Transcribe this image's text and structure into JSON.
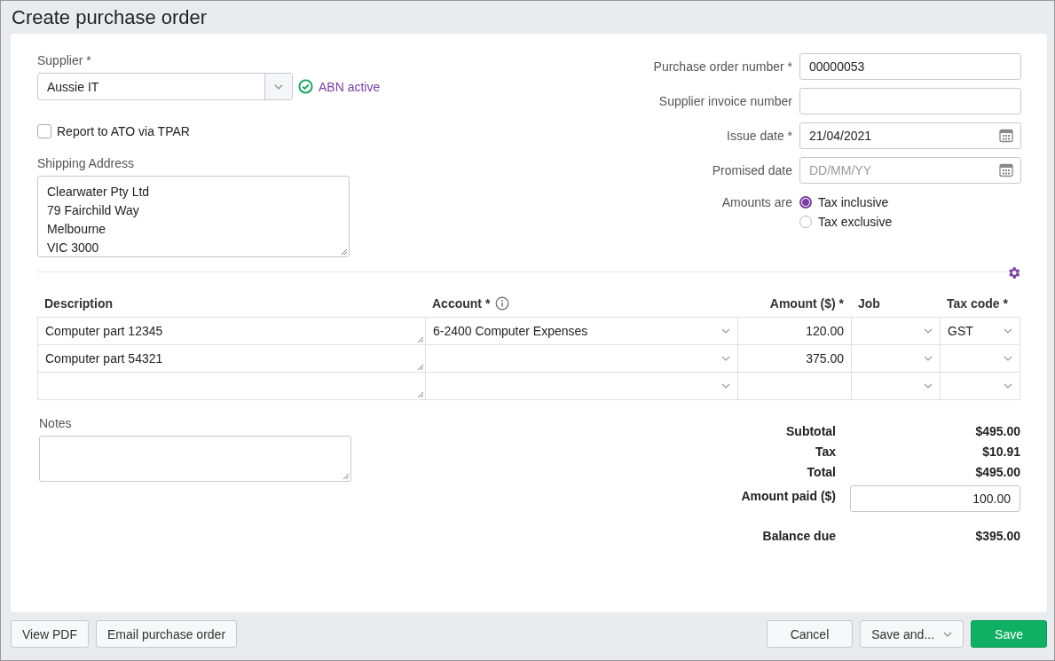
{
  "title": "Create purchase order",
  "supplier": {
    "label": "Supplier *",
    "value": "Aussie IT",
    "status": "ABN active"
  },
  "tpar": {
    "label": "Report to ATO via TPAR",
    "checked": false
  },
  "shipping": {
    "label": "Shipping Address",
    "lines": [
      "Clearwater Pty Ltd",
      "79 Fairchild Way",
      "Melbourne",
      "VIC 3000"
    ]
  },
  "fields": [
    {
      "label": "Purchase order number *",
      "value": "00000053",
      "kind": "text"
    },
    {
      "label": "Supplier invoice number",
      "kind": "text"
    },
    {
      "label": "Issue date *",
      "value": "21/04/2021",
      "kind": "date"
    },
    {
      "label": "Promised date",
      "placeholder": "DD/MM/YY",
      "kind": "date"
    }
  ],
  "amounts": {
    "label": "Amounts are",
    "options": [
      {
        "label": "Tax inclusive",
        "selected": true
      },
      {
        "label": "Tax exclusive",
        "selected": false
      }
    ]
  },
  "table": {
    "columns": [
      {
        "label": "Description"
      },
      {
        "label": "Account *",
        "info": true
      },
      {
        "label": "Amount ($) *"
      },
      {
        "label": "Job"
      },
      {
        "label": "Tax code *"
      }
    ],
    "rows": [
      {
        "description": "Computer part 12345",
        "account": "6-2400 Computer Expenses",
        "amount": "120.00",
        "tax_code": "GST"
      },
      {
        "description": "Computer part 54321",
        "amount": "375.00"
      },
      {}
    ]
  },
  "notes": {
    "label": "Notes"
  },
  "totals": [
    {
      "label": "Subtotal",
      "value": "$495.00",
      "kind": "text"
    },
    {
      "label": "Tax",
      "value": "$10.91",
      "kind": "text"
    },
    {
      "label": "Total",
      "value": "$495.00",
      "kind": "text"
    },
    {
      "label": "Amount paid ($)",
      "value": "100.00",
      "kind": "input"
    },
    {
      "label": "Balance due",
      "value": "$395.00",
      "kind": "text"
    }
  ],
  "footer": {
    "left": [
      "View PDF",
      "Email purchase order"
    ],
    "right": [
      {
        "label": "Cancel",
        "kind": "plain"
      },
      {
        "label": "Save and...",
        "kind": "menu"
      },
      {
        "label": "Save",
        "kind": "primary"
      }
    ]
  }
}
